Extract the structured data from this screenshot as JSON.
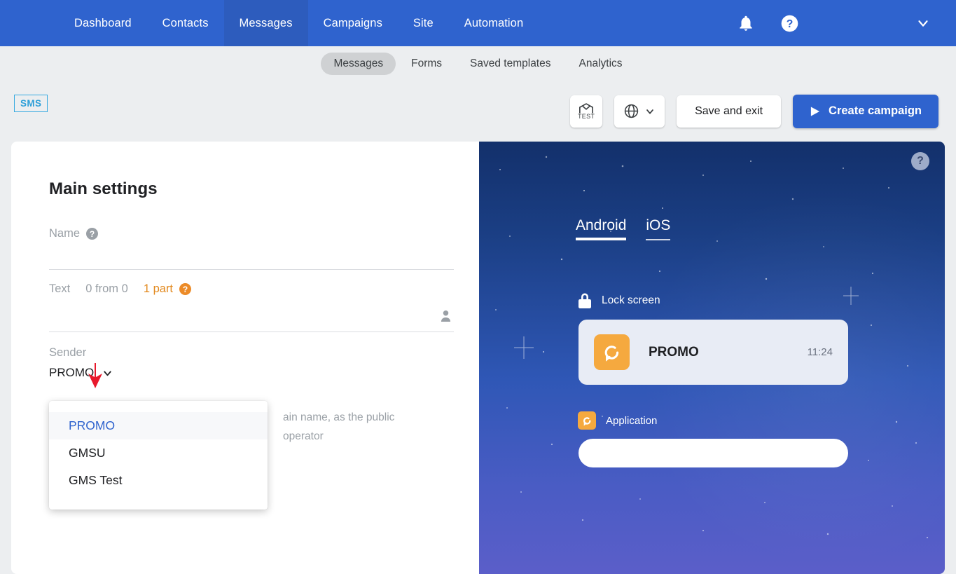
{
  "topnav": {
    "items": [
      {
        "label": "Dashboard",
        "active": false
      },
      {
        "label": "Contacts",
        "active": false
      },
      {
        "label": "Messages",
        "active": true
      },
      {
        "label": "Campaigns",
        "active": false
      },
      {
        "label": "Site",
        "active": false
      },
      {
        "label": "Automation",
        "active": false
      }
    ],
    "icons": [
      "bell-icon",
      "help-circle-icon",
      "chevron-down-icon"
    ],
    "background_color": "#2f63ce"
  },
  "subnav": {
    "tabs": [
      {
        "label": "Messages",
        "active": true
      },
      {
        "label": "Forms",
        "active": false
      },
      {
        "label": "Saved templates",
        "active": false
      },
      {
        "label": "Analytics",
        "active": false
      }
    ]
  },
  "actionbar": {
    "channel_badge": "SMS",
    "channel_badge_color": "#2e9fd8",
    "test_button_label": "TEST",
    "save_label": "Save and exit",
    "create_label": "Create campaign",
    "create_color": "#2f63ce"
  },
  "form": {
    "title": "Main settings",
    "name": {
      "label": "Name",
      "value": "",
      "help": "?"
    },
    "text": {
      "label": "Text",
      "count_current": "0",
      "count_sep": "from",
      "count_total": "0",
      "parts": "1 part",
      "parts_color": "#e2891e",
      "value": ""
    },
    "sender": {
      "label": "Sender",
      "value": "PROMO",
      "hint_line1": "ain name, as the public",
      "hint_line2": "operator",
      "options": [
        {
          "label": "PROMO",
          "selected": true
        },
        {
          "label": "GMSU",
          "selected": false
        },
        {
          "label": "GMS Test",
          "selected": false
        }
      ]
    }
  },
  "preview": {
    "os_tabs": [
      {
        "label": "Android",
        "active": true
      },
      {
        "label": "iOS",
        "active": false
      }
    ],
    "lock_screen_label": "Lock screen",
    "notification": {
      "title": "PROMO",
      "time": "11:24",
      "body": ""
    },
    "application_label": "Application",
    "help": "?"
  }
}
